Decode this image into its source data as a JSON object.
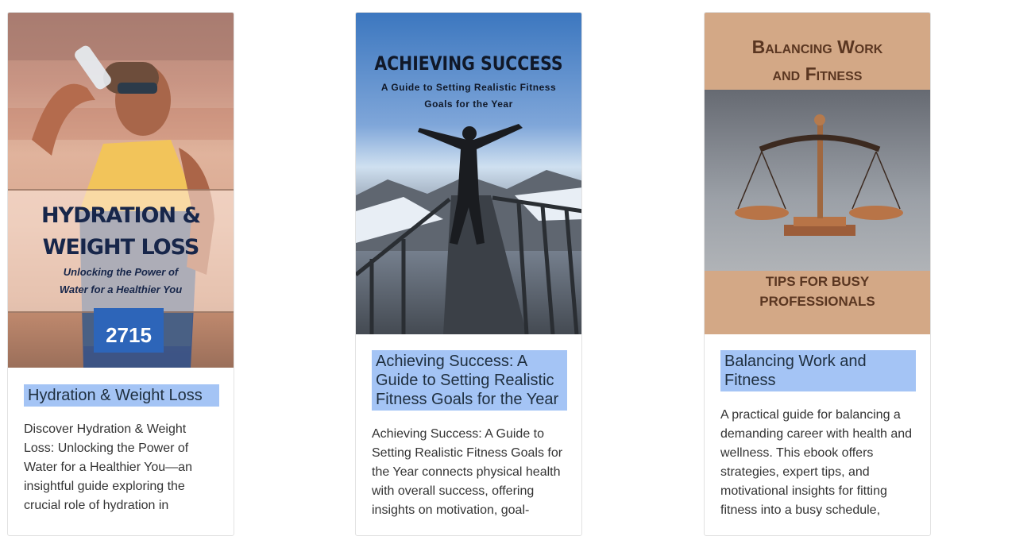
{
  "books": [
    {
      "cover_title": "HYDRATION & WEIGHT LOSS",
      "cover_subtitle": "Unlocking the Power of Water for a Healthier You",
      "cover_bib": "2715",
      "title": "Hydration & Weight Loss",
      "description": "Discover Hydration & Weight Loss: Unlocking the Power of Water for a Healthier You—an insightful guide exploring the crucial role of hydration in"
    },
    {
      "cover_title": "ACHIEVING SUCCESS",
      "cover_subtitle": "A Guide to Setting Realistic Fitness Goals for the Year",
      "title": "Achieving Success: A Guide to Setting Realistic Fitness Goals for the Year",
      "description": "Achieving Success: A Guide to Setting Realistic Fitness Goals for the Year connects physical health with overall success, offering insights on motivation, goal-"
    },
    {
      "cover_title": "Balancing Work and Fitness",
      "cover_subtitle": "TIPS FOR BUSY PROFESSIONALS",
      "title": "Balancing Work and Fitness",
      "description": "A practical guide for balancing a demanding career with health and wellness. This ebook offers strategies, expert tips, and motivational insights for fitting fitness into a busy schedule,"
    }
  ],
  "colors": {
    "title_bg": "#a4c4f5",
    "text": "#333333"
  }
}
